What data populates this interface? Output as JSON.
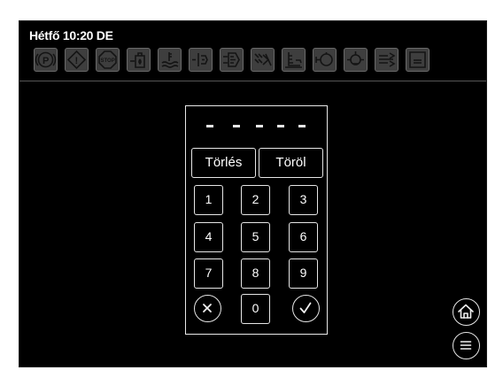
{
  "status": {
    "datetime": "Hétfő 10:20 DE"
  },
  "telltales": [
    {
      "icon": "parking-brake-icon",
      "text": "P"
    },
    {
      "icon": "warning-icon",
      "text": "!"
    },
    {
      "icon": "stop-icon",
      "text": "STOP"
    },
    {
      "icon": "fuel-water-icon",
      "text": ""
    },
    {
      "icon": "coolant-level-icon",
      "text": ""
    },
    {
      "icon": "fuel-filter-icon",
      "text": ""
    },
    {
      "icon": "fuel-filter-restriction-icon",
      "text": ""
    },
    {
      "icon": "air-filter-icon",
      "text": ""
    },
    {
      "icon": "oil-pressure-icon",
      "text": ""
    },
    {
      "icon": "engine-icon",
      "text": ""
    },
    {
      "icon": "engine-temperature-icon",
      "text": ""
    },
    {
      "icon": "transmission-icon",
      "text": ""
    },
    {
      "icon": "battery-icon",
      "text": ""
    }
  ],
  "keypad": {
    "pin_placeholder": [
      "-",
      "-",
      "-",
      "-",
      "-"
    ],
    "clear_label": "Törlés",
    "delete_label": "Töröl",
    "keys": [
      "1",
      "2",
      "3",
      "4",
      "5",
      "6",
      "7",
      "8",
      "9"
    ],
    "zero": "0",
    "cancel_icon": "x-circle-icon",
    "confirm_icon": "check-circle-icon"
  },
  "nav": {
    "home_icon": "home-icon",
    "menu_icon": "menu-icon"
  },
  "colors": {
    "background": "#000000",
    "foreground": "#ffffff",
    "inactive_telltale": "#3e3e3e"
  }
}
